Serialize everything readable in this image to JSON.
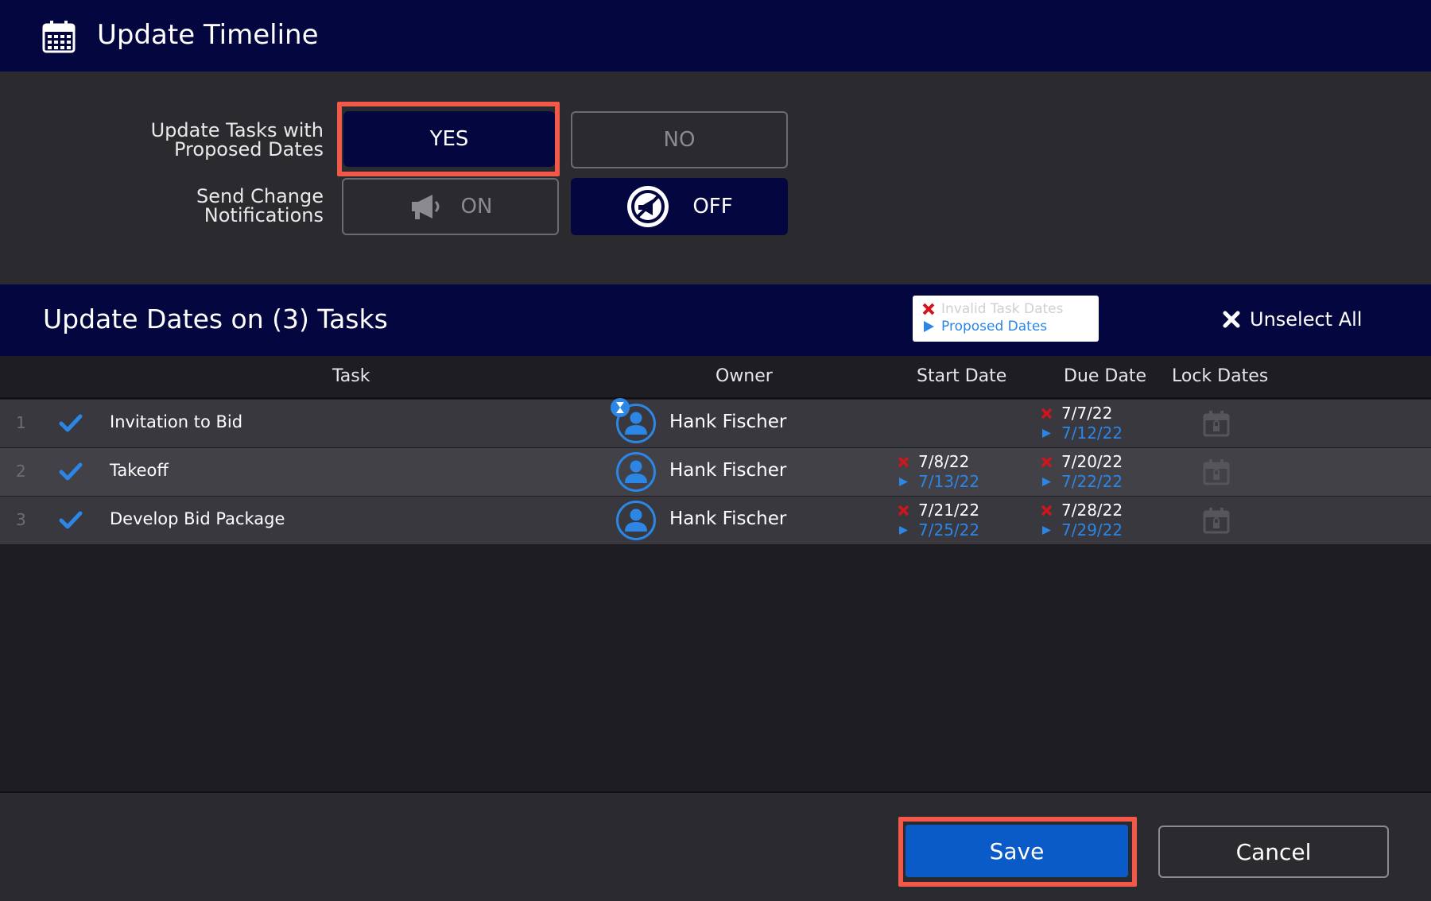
{
  "dialog": {
    "title": "Update Timeline",
    "title_icon": "calendar-icon"
  },
  "settings": {
    "update_tasks_label_line1": "Update Tasks with",
    "update_tasks_label_line2": "Proposed Dates",
    "yes_label": "YES",
    "no_label": "NO",
    "update_tasks_selected": "YES",
    "notifications_label_line1": "Send Change",
    "notifications_label_line2": "Notifications",
    "on_label": "ON",
    "off_label": "OFF",
    "notifications_selected": "OFF",
    "on_icon": "megaphone-icon",
    "off_icon": "megaphone-off-icon"
  },
  "tasks_section": {
    "title": "Update Dates on (3) Tasks",
    "legend": {
      "invalid_label": "Invalid Task Dates",
      "proposed_label": "Proposed Dates"
    },
    "unselect_all_label": "Unselect All"
  },
  "table": {
    "columns": {
      "task": "Task",
      "owner": "Owner",
      "start_date": "Start Date",
      "due_date": "Due Date",
      "lock_dates": "Lock Dates"
    },
    "rows": [
      {
        "num": "1",
        "selected": true,
        "task": "Invitation to Bid",
        "owner": "Hank Fischer",
        "owner_pending": true,
        "start_old": "",
        "start_new": "",
        "due_old": "7/7/22",
        "due_new": "7/12/22"
      },
      {
        "num": "2",
        "selected": true,
        "task": "Takeoff",
        "owner": "Hank Fischer",
        "owner_pending": false,
        "start_old": "7/8/22",
        "start_new": "7/13/22",
        "due_old": "7/20/22",
        "due_new": "7/22/22"
      },
      {
        "num": "3",
        "selected": true,
        "task": "Develop Bid Package",
        "owner": "Hank Fischer",
        "owner_pending": false,
        "start_old": "7/21/22",
        "start_new": "7/25/22",
        "due_old": "7/28/22",
        "due_new": "7/29/22"
      }
    ]
  },
  "footer": {
    "save_label": "Save",
    "cancel_label": "Cancel"
  },
  "colors": {
    "navy": "#04063f",
    "accent_blue": "#2b86e6",
    "save_blue": "#0a5ac7",
    "invalid_red": "#d0161a",
    "highlight": "#f2594a"
  }
}
